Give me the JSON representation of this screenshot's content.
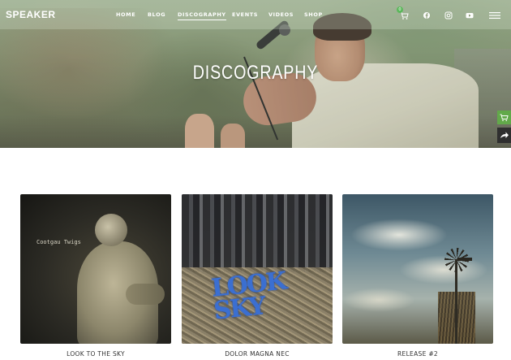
{
  "brand": {
    "logo": "SPEAKER"
  },
  "nav": {
    "items": [
      {
        "label": "HOME",
        "active": false
      },
      {
        "label": "BLOG",
        "active": false
      },
      {
        "label": "DISCOGRAPHY",
        "active": true
      },
      {
        "label": "EVENTS",
        "active": false
      },
      {
        "label": "VIDEOS",
        "active": false
      },
      {
        "label": "SHOP",
        "active": false
      }
    ],
    "cart_count": "0",
    "icons": [
      "cart-icon",
      "facebook-icon",
      "instagram-icon",
      "youtube-icon",
      "hamburger-menu-icon"
    ]
  },
  "hero": {
    "title": "DISCOGRAPHY"
  },
  "side_widgets": {
    "icons": [
      "cart-icon",
      "share-icon"
    ],
    "colors": {
      "cart": "#62a94a",
      "share": "#2f2f2f"
    }
  },
  "albums": [
    {
      "title": "LOOK TO THE SKY",
      "cover_text": "Cootgau Twigs"
    },
    {
      "title": "DOLOR MAGNA NEC",
      "cover_text": "LOOK SKY"
    },
    {
      "title": "RELEASE #2",
      "cover_text": ""
    }
  ],
  "colors": {
    "accent_green": "#5cb85c",
    "text_dark": "#333333",
    "nav_text": "#ffffff"
  }
}
